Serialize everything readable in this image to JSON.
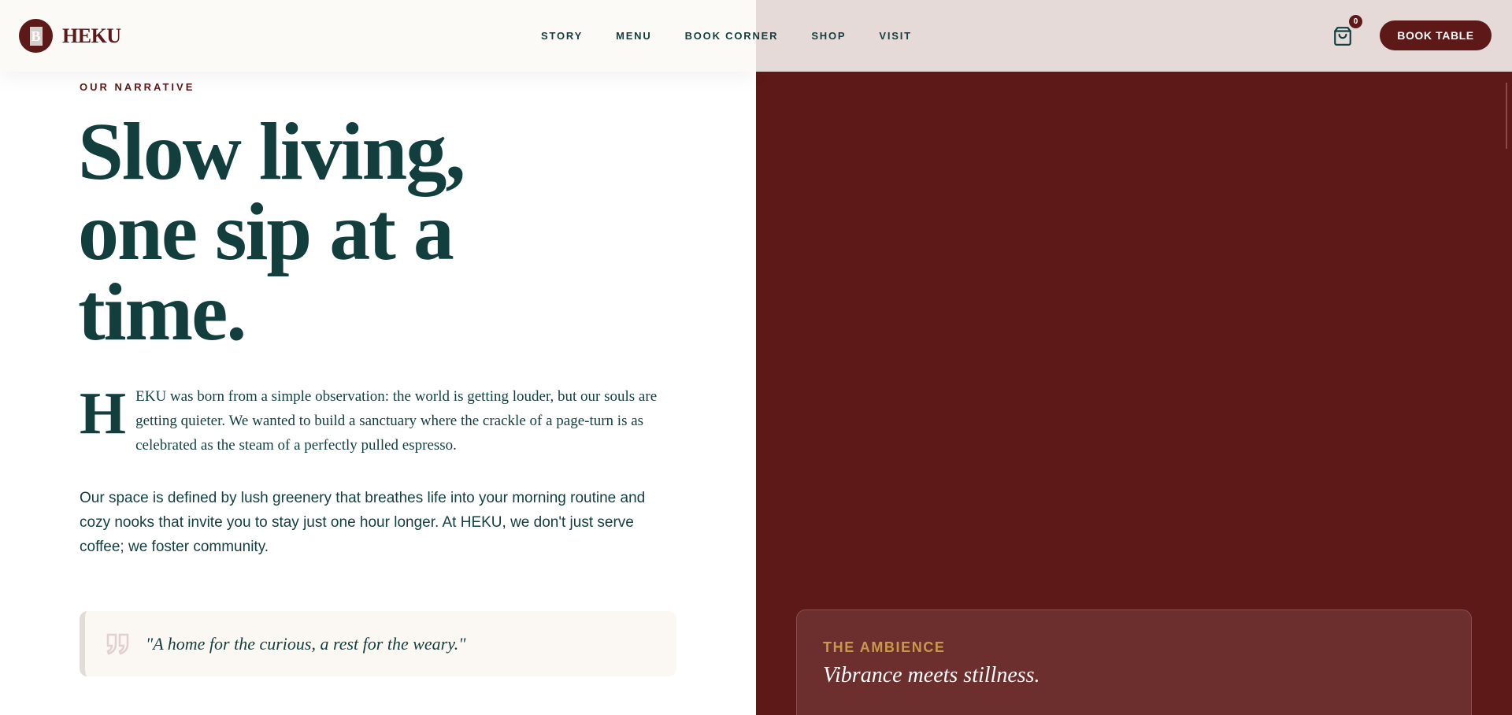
{
  "header": {
    "brand_name": "HEKU",
    "brand_mark_letter": "B",
    "nav": [
      {
        "label": "STORY"
      },
      {
        "label": "MENU"
      },
      {
        "label": "BOOK CORNER"
      },
      {
        "label": "SHOP"
      },
      {
        "label": "VISIT"
      }
    ],
    "cart_count": "0",
    "book_button": "BOOK TABLE"
  },
  "narrative": {
    "eyebrow": "OUR NARRATIVE",
    "headline_line1": "Slow living,",
    "headline_line2": "one sip at a",
    "headline_line3": "time.",
    "lead_dropcap": "H",
    "lead_rest": "EKU was born from a simple observation: the world is getting louder, but our souls are getting quieter. We wanted to build a sanctuary where the crackle of a page-turn is as celebrated as the steam of a perfectly pulled espresso.",
    "body": "Our space is defined by lush greenery that breathes life into your morning routine and cozy nooks that invite you to stay just one hour longer. At HEKU, we don't just serve coffee; we foster community.",
    "quote": "\"A home for the curious, a rest for the weary.\""
  },
  "ambience": {
    "label": "THE AMBIENCE",
    "title": "Vibrance meets stillness."
  },
  "colors": {
    "brand": "#5c1918",
    "ink": "#123f3e",
    "gold": "#c99a4a"
  },
  "icons": {
    "cart": "shopping-bag-icon",
    "quote": "quote-mark-icon"
  }
}
